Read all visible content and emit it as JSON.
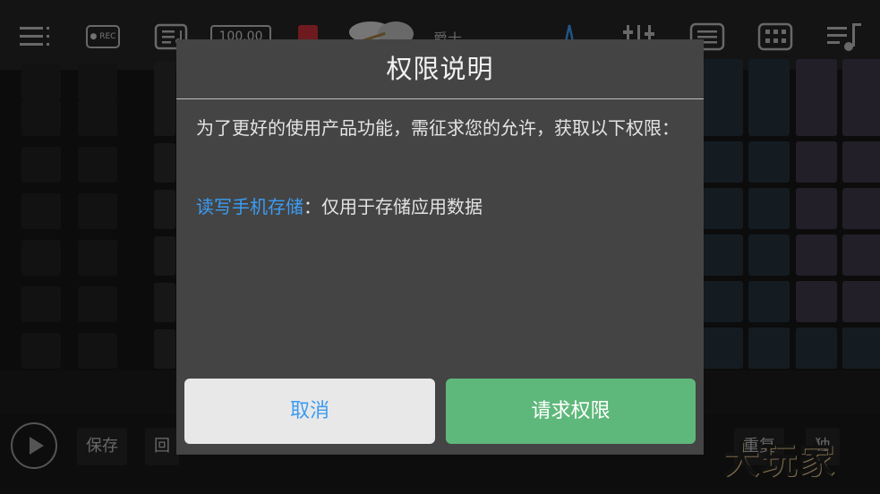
{
  "toolbar": {
    "rec_label": "● REC",
    "bpm": "100.00",
    "kit_name": "爵士",
    "icons": [
      "menu-icon",
      "rec-icon",
      "music-note-icon",
      "bpm-display",
      "record-red-icon",
      "drum-kit-icon",
      "metronome-icon",
      "mixer-icon",
      "settings-panel-icon",
      "pad-grid-icon",
      "playlist-icon"
    ]
  },
  "bottom": {
    "save_label": "保存",
    "playback_label": "回",
    "reset_label": "重复",
    "solo_label": "独"
  },
  "watermark": "大玩家",
  "dialog": {
    "title": "权限说明",
    "message": "为了更好的使用产品功能，需征求您的允许，获取以下权限：",
    "permission_name": "读写手机存储",
    "permission_desc": "：仅用于存储应用数据",
    "cancel_label": "取消",
    "request_label": "请求权限"
  },
  "colors": {
    "link_blue": "#3b9cf2",
    "confirm_green": "#5fb87b",
    "dialog_bg": "#444444"
  }
}
